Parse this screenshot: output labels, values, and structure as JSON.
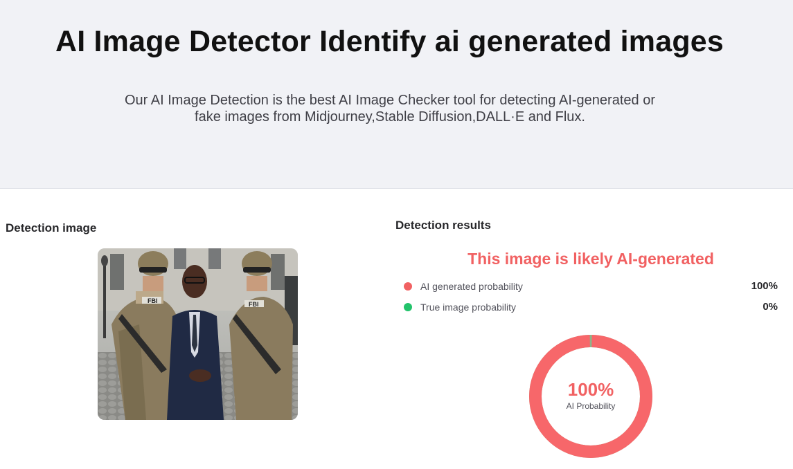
{
  "hero": {
    "title": "AI Image Detector Identify ai generated images",
    "subtitle_line1": "Our AI Image Detection is the best AI Image Checker tool for detecting AI-generated or",
    "subtitle_line2": "fake images from Midjourney,Stable Diffusion,DALL·E and Flux."
  },
  "detection_image": {
    "label": "Detection image",
    "vest_text": "FBI"
  },
  "results": {
    "label": "Detection results",
    "verdict": "This image is likely AI-generated",
    "rows": [
      {
        "name": "AI generated probability",
        "value": "100%",
        "color": "#f16162"
      },
      {
        "name": "True image probability",
        "value": "0%",
        "color": "#22c36b"
      }
    ],
    "donut": {
      "percent_text": "100%",
      "caption": "AI Probability",
      "ai_fraction": 1.0,
      "ring_color": "#f7676a",
      "gap_color": "#8fb389"
    }
  }
}
